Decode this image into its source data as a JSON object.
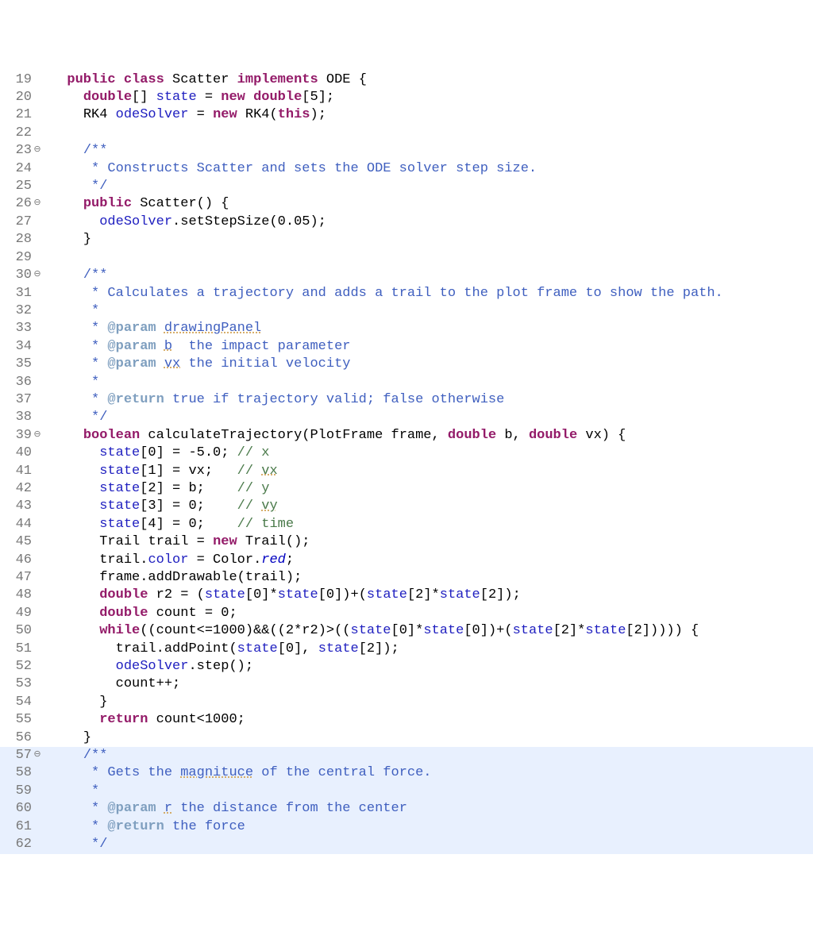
{
  "lines": [
    {
      "num": "19",
      "fold": "",
      "indent": "  ",
      "tokens": [
        {
          "t": "public",
          "c": "kw"
        },
        {
          "t": " ",
          "c": "black"
        },
        {
          "t": "class",
          "c": "kw"
        },
        {
          "t": " Scatter ",
          "c": "black"
        },
        {
          "t": "implements",
          "c": "kw"
        },
        {
          "t": " ODE {",
          "c": "black"
        }
      ]
    },
    {
      "num": "20",
      "fold": "",
      "indent": "    ",
      "tokens": [
        {
          "t": "double",
          "c": "kw"
        },
        {
          "t": "[] ",
          "c": "black"
        },
        {
          "t": "state",
          "c": "field"
        },
        {
          "t": " = ",
          "c": "black"
        },
        {
          "t": "new",
          "c": "kw"
        },
        {
          "t": " ",
          "c": "black"
        },
        {
          "t": "double",
          "c": "kw"
        },
        {
          "t": "[5];",
          "c": "black"
        }
      ]
    },
    {
      "num": "21",
      "fold": "",
      "indent": "    ",
      "tokens": [
        {
          "t": "RK4 ",
          "c": "black"
        },
        {
          "t": "odeSolver",
          "c": "field"
        },
        {
          "t": " = ",
          "c": "black"
        },
        {
          "t": "new",
          "c": "kw"
        },
        {
          "t": " RK4(",
          "c": "black"
        },
        {
          "t": "this",
          "c": "kw"
        },
        {
          "t": ");",
          "c": "black"
        }
      ]
    },
    {
      "num": "22",
      "fold": "",
      "indent": "",
      "tokens": []
    },
    {
      "num": "23",
      "fold": "⊖",
      "indent": "    ",
      "tokens": [
        {
          "t": "/**",
          "c": "javadoc"
        }
      ]
    },
    {
      "num": "24",
      "fold": "",
      "indent": "     ",
      "tokens": [
        {
          "t": "* Constructs Scatter and sets the ODE solver step size.",
          "c": "javadoc"
        }
      ]
    },
    {
      "num": "25",
      "fold": "",
      "indent": "     ",
      "tokens": [
        {
          "t": "*/",
          "c": "javadoc"
        }
      ]
    },
    {
      "num": "26",
      "fold": "⊖",
      "indent": "    ",
      "tokens": [
        {
          "t": "public",
          "c": "kw"
        },
        {
          "t": " Scatter() {",
          "c": "black"
        }
      ]
    },
    {
      "num": "27",
      "fold": "",
      "indent": "      ",
      "tokens": [
        {
          "t": "odeSolver",
          "c": "field"
        },
        {
          "t": ".setStepSize(0.05);",
          "c": "black"
        }
      ]
    },
    {
      "num": "28",
      "fold": "",
      "indent": "    ",
      "tokens": [
        {
          "t": "}",
          "c": "black"
        }
      ]
    },
    {
      "num": "29",
      "fold": "",
      "indent": "",
      "tokens": []
    },
    {
      "num": "30",
      "fold": "⊖",
      "indent": "    ",
      "tokens": [
        {
          "t": "/**",
          "c": "javadoc"
        }
      ]
    },
    {
      "num": "31",
      "fold": "",
      "indent": "     ",
      "tokens": [
        {
          "t": "* Calculates a trajectory and adds a trail to the plot frame to show the path.",
          "c": "javadoc"
        }
      ]
    },
    {
      "num": "32",
      "fold": "",
      "indent": "     ",
      "tokens": [
        {
          "t": "*",
          "c": "javadoc"
        }
      ]
    },
    {
      "num": "33",
      "fold": "",
      "indent": "     ",
      "tokens": [
        {
          "t": "* ",
          "c": "javadoc"
        },
        {
          "t": "@param",
          "c": "javadoc-tag"
        },
        {
          "t": " ",
          "c": "javadoc"
        },
        {
          "t": "drawingPanel",
          "c": "javadoc underline-dotted"
        }
      ]
    },
    {
      "num": "34",
      "fold": "",
      "indent": "     ",
      "tokens": [
        {
          "t": "* ",
          "c": "javadoc"
        },
        {
          "t": "@param",
          "c": "javadoc-tag"
        },
        {
          "t": " ",
          "c": "javadoc"
        },
        {
          "t": "b",
          "c": "javadoc underline-dotted"
        },
        {
          "t": "  the impact parameter",
          "c": "javadoc"
        }
      ]
    },
    {
      "num": "35",
      "fold": "",
      "indent": "     ",
      "tokens": [
        {
          "t": "* ",
          "c": "javadoc"
        },
        {
          "t": "@param",
          "c": "javadoc-tag"
        },
        {
          "t": " ",
          "c": "javadoc"
        },
        {
          "t": "vx",
          "c": "javadoc underline-dotted"
        },
        {
          "t": " the initial velocity",
          "c": "javadoc"
        }
      ]
    },
    {
      "num": "36",
      "fold": "",
      "indent": "     ",
      "tokens": [
        {
          "t": "*",
          "c": "javadoc"
        }
      ]
    },
    {
      "num": "37",
      "fold": "",
      "indent": "     ",
      "tokens": [
        {
          "t": "* ",
          "c": "javadoc"
        },
        {
          "t": "@return",
          "c": "javadoc-tag"
        },
        {
          "t": " true if trajectory valid; false otherwise",
          "c": "javadoc"
        }
      ]
    },
    {
      "num": "38",
      "fold": "",
      "indent": "     ",
      "tokens": [
        {
          "t": "*/",
          "c": "javadoc"
        }
      ]
    },
    {
      "num": "39",
      "fold": "⊖",
      "indent": "    ",
      "tokens": [
        {
          "t": "boolean",
          "c": "kw"
        },
        {
          "t": " calculateTrajectory(PlotFrame ",
          "c": "black"
        },
        {
          "t": "frame",
          "c": "black"
        },
        {
          "t": ", ",
          "c": "black"
        },
        {
          "t": "double",
          "c": "kw"
        },
        {
          "t": " ",
          "c": "black"
        },
        {
          "t": "b",
          "c": "black"
        },
        {
          "t": ", ",
          "c": "black"
        },
        {
          "t": "double",
          "c": "kw"
        },
        {
          "t": " ",
          "c": "black"
        },
        {
          "t": "vx",
          "c": "black"
        },
        {
          "t": ") {",
          "c": "black"
        }
      ]
    },
    {
      "num": "40",
      "fold": "",
      "indent": "      ",
      "tokens": [
        {
          "t": "state",
          "c": "field"
        },
        {
          "t": "[0] = -5.0; ",
          "c": "black"
        },
        {
          "t": "// x",
          "c": "comment"
        }
      ]
    },
    {
      "num": "41",
      "fold": "",
      "indent": "      ",
      "tokens": [
        {
          "t": "state",
          "c": "field"
        },
        {
          "t": "[1] = ",
          "c": "black"
        },
        {
          "t": "vx",
          "c": "black"
        },
        {
          "t": ";   ",
          "c": "black"
        },
        {
          "t": "// ",
          "c": "comment"
        },
        {
          "t": "vx",
          "c": "comment underline-dotted"
        }
      ]
    },
    {
      "num": "42",
      "fold": "",
      "indent": "      ",
      "tokens": [
        {
          "t": "state",
          "c": "field"
        },
        {
          "t": "[2] = ",
          "c": "black"
        },
        {
          "t": "b",
          "c": "black"
        },
        {
          "t": ";    ",
          "c": "black"
        },
        {
          "t": "// y",
          "c": "comment"
        }
      ]
    },
    {
      "num": "43",
      "fold": "",
      "indent": "      ",
      "tokens": [
        {
          "t": "state",
          "c": "field"
        },
        {
          "t": "[3] = 0;    ",
          "c": "black"
        },
        {
          "t": "// ",
          "c": "comment"
        },
        {
          "t": "vy",
          "c": "comment underline-dotted"
        }
      ]
    },
    {
      "num": "44",
      "fold": "",
      "indent": "      ",
      "tokens": [
        {
          "t": "state",
          "c": "field"
        },
        {
          "t": "[4] = 0;    ",
          "c": "black"
        },
        {
          "t": "// time",
          "c": "comment"
        }
      ]
    },
    {
      "num": "45",
      "fold": "",
      "indent": "      ",
      "tokens": [
        {
          "t": "Trail ",
          "c": "black"
        },
        {
          "t": "trail",
          "c": "black"
        },
        {
          "t": " = ",
          "c": "black"
        },
        {
          "t": "new",
          "c": "kw"
        },
        {
          "t": " Trail();",
          "c": "black"
        }
      ]
    },
    {
      "num": "46",
      "fold": "",
      "indent": "      ",
      "tokens": [
        {
          "t": "trail",
          "c": "black"
        },
        {
          "t": ".",
          "c": "black"
        },
        {
          "t": "color",
          "c": "field"
        },
        {
          "t": " = Color.",
          "c": "black"
        },
        {
          "t": "red",
          "c": "static-field"
        },
        {
          "t": ";",
          "c": "black"
        }
      ]
    },
    {
      "num": "47",
      "fold": "",
      "indent": "      ",
      "tokens": [
        {
          "t": "frame",
          "c": "black"
        },
        {
          "t": ".addDrawable(",
          "c": "black"
        },
        {
          "t": "trail",
          "c": "black"
        },
        {
          "t": ");",
          "c": "black"
        }
      ]
    },
    {
      "num": "48",
      "fold": "",
      "indent": "      ",
      "tokens": [
        {
          "t": "double",
          "c": "kw"
        },
        {
          "t": " ",
          "c": "black"
        },
        {
          "t": "r2",
          "c": "black"
        },
        {
          "t": " = (",
          "c": "black"
        },
        {
          "t": "state",
          "c": "field"
        },
        {
          "t": "[0]*",
          "c": "black"
        },
        {
          "t": "state",
          "c": "field"
        },
        {
          "t": "[0])+(",
          "c": "black"
        },
        {
          "t": "state",
          "c": "field"
        },
        {
          "t": "[2]*",
          "c": "black"
        },
        {
          "t": "state",
          "c": "field"
        },
        {
          "t": "[2]);",
          "c": "black"
        }
      ]
    },
    {
      "num": "49",
      "fold": "",
      "indent": "      ",
      "tokens": [
        {
          "t": "double",
          "c": "kw"
        },
        {
          "t": " ",
          "c": "black"
        },
        {
          "t": "count",
          "c": "black"
        },
        {
          "t": " = 0;",
          "c": "black"
        }
      ]
    },
    {
      "num": "50",
      "fold": "",
      "indent": "      ",
      "tokens": [
        {
          "t": "while",
          "c": "kw"
        },
        {
          "t": "((",
          "c": "black"
        },
        {
          "t": "count",
          "c": "black"
        },
        {
          "t": "<=1000)&&((2*",
          "c": "black"
        },
        {
          "t": "r2",
          "c": "black"
        },
        {
          "t": ")>((",
          "c": "black"
        },
        {
          "t": "state",
          "c": "field"
        },
        {
          "t": "[0]*",
          "c": "black"
        },
        {
          "t": "state",
          "c": "field"
        },
        {
          "t": "[0])+(",
          "c": "black"
        },
        {
          "t": "state",
          "c": "field"
        },
        {
          "t": "[2]*",
          "c": "black"
        },
        {
          "t": "state",
          "c": "field"
        },
        {
          "t": "[2])))) {",
          "c": "black"
        }
      ]
    },
    {
      "num": "51",
      "fold": "",
      "indent": "        ",
      "tokens": [
        {
          "t": "trail",
          "c": "black"
        },
        {
          "t": ".addPoint(",
          "c": "black"
        },
        {
          "t": "state",
          "c": "field"
        },
        {
          "t": "[0], ",
          "c": "black"
        },
        {
          "t": "state",
          "c": "field"
        },
        {
          "t": "[2]);",
          "c": "black"
        }
      ]
    },
    {
      "num": "52",
      "fold": "",
      "indent": "        ",
      "tokens": [
        {
          "t": "odeSolver",
          "c": "field"
        },
        {
          "t": ".step();",
          "c": "black"
        }
      ]
    },
    {
      "num": "53",
      "fold": "",
      "indent": "        ",
      "tokens": [
        {
          "t": "count",
          "c": "black"
        },
        {
          "t": "++;",
          "c": "black"
        }
      ]
    },
    {
      "num": "54",
      "fold": "",
      "indent": "      ",
      "tokens": [
        {
          "t": "}",
          "c": "black"
        }
      ]
    },
    {
      "num": "55",
      "fold": "",
      "indent": "      ",
      "tokens": [
        {
          "t": "return",
          "c": "kw"
        },
        {
          "t": " ",
          "c": "black"
        },
        {
          "t": "count",
          "c": "black"
        },
        {
          "t": "<1000;",
          "c": "black"
        }
      ]
    },
    {
      "num": "56",
      "fold": "",
      "indent": "    ",
      "tokens": [
        {
          "t": "}",
          "c": "black"
        }
      ]
    },
    {
      "num": "57",
      "fold": "⊖",
      "indent": "    ",
      "highlighted": true,
      "tokens": [
        {
          "t": "/**",
          "c": "javadoc"
        }
      ]
    },
    {
      "num": "58",
      "fold": "",
      "indent": "     ",
      "highlighted": true,
      "tokens": [
        {
          "t": "* Gets the ",
          "c": "javadoc"
        },
        {
          "t": "magnituce",
          "c": "javadoc underline-dotted"
        },
        {
          "t": " of the central force.",
          "c": "javadoc"
        }
      ]
    },
    {
      "num": "59",
      "fold": "",
      "indent": "     ",
      "highlighted": true,
      "tokens": [
        {
          "t": "*",
          "c": "javadoc"
        }
      ]
    },
    {
      "num": "60",
      "fold": "",
      "indent": "     ",
      "highlighted": true,
      "tokens": [
        {
          "t": "* ",
          "c": "javadoc"
        },
        {
          "t": "@param",
          "c": "javadoc-tag"
        },
        {
          "t": " ",
          "c": "javadoc"
        },
        {
          "t": "r",
          "c": "javadoc underline-dotted"
        },
        {
          "t": " the distance from the center",
          "c": "javadoc"
        }
      ]
    },
    {
      "num": "61",
      "fold": "",
      "indent": "     ",
      "highlighted": true,
      "tokens": [
        {
          "t": "* ",
          "c": "javadoc"
        },
        {
          "t": "@return",
          "c": "javadoc-tag"
        },
        {
          "t": " the force",
          "c": "javadoc"
        }
      ]
    },
    {
      "num": "62",
      "fold": "",
      "indent": "     ",
      "highlighted": true,
      "tokens": [
        {
          "t": "*/",
          "c": "javadoc"
        }
      ]
    }
  ]
}
